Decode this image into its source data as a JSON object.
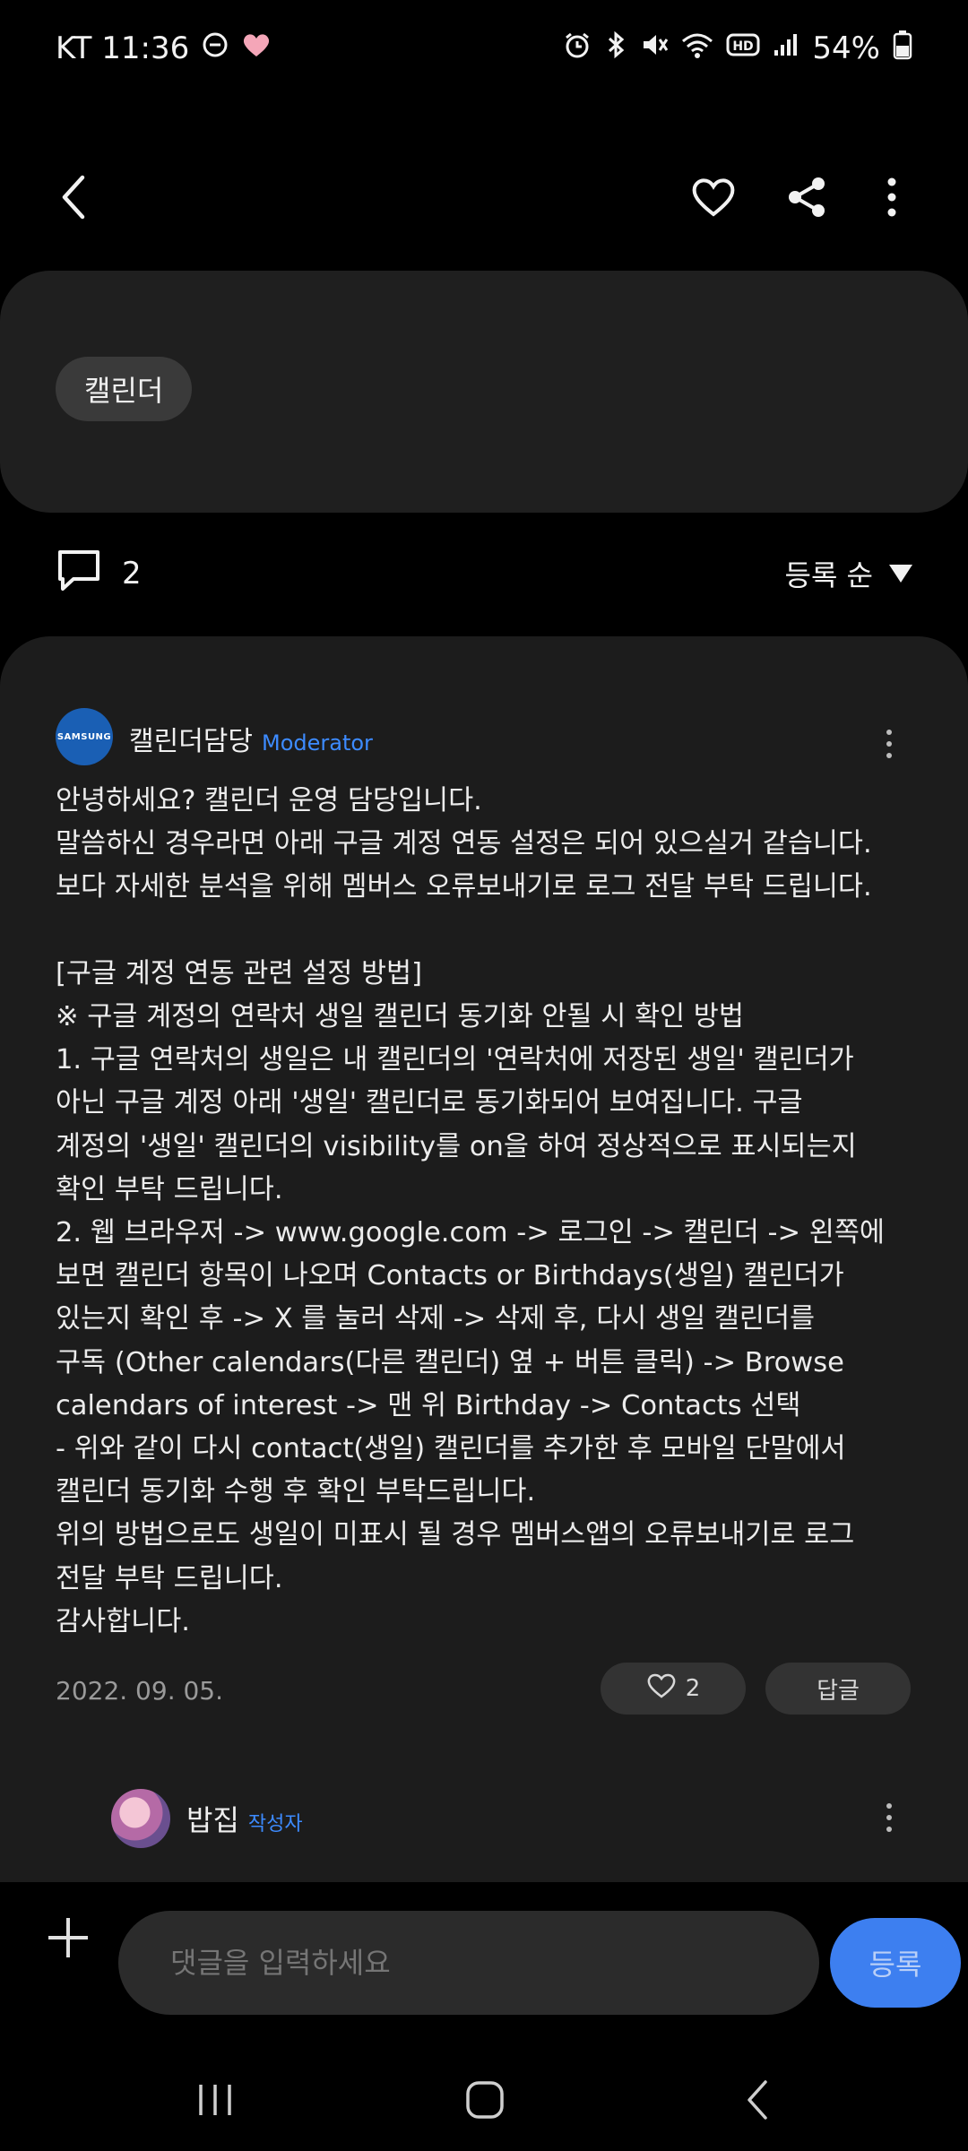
{
  "status_bar": {
    "carrier_time": "KT 11:36",
    "battery": "54%",
    "left_icons": [
      "do-not-disturb-icon",
      "heart-icon"
    ],
    "right_icons": [
      "alarm-icon",
      "bluetooth-icon",
      "mute-icon",
      "wifi-icon",
      "hd-icon",
      "signal-icon",
      "battery-icon"
    ]
  },
  "top_bar": {
    "icons": [
      "back-icon",
      "heart-outline-icon",
      "share-icon",
      "more-icon"
    ]
  },
  "tag": {
    "label": "캘린더"
  },
  "comments_header": {
    "count": "2",
    "sort_label": "등록 순"
  },
  "comment": {
    "author": "캘린더담당",
    "badge": "Moderator",
    "avatar_text": "SAMSUNG",
    "body": "안녕하세요? 캘린더 운영 담당입니다.\n말씀하신 경우라면 아래 구글 계정 연동 설정은 되어 있으실거 같습니다.\n보다 자세한 분석을 위해 멤버스 오류보내기로 로그 전달 부탁 드립니다.\n\n[구글 계정 연동 관련 설정 방법]\n※ 구글 계정의 연락처 생일 캘린더 동기화 안될 시 확인 방법\n1. 구글 연락처의 생일은 내 캘린더의 '연락처에 저장된 생일' 캘린더가\n아닌 구글 계정 아래 '생일' 캘린더로 동기화되어 보여집니다. 구글\n계정의 '생일' 캘린더의 visibility를 on을 하여 정상적으로 표시되는지\n확인 부탁 드립니다.\n2. 웹 브라우저 -> www.google.com -> 로그인 -> 캘린더 -> 왼쪽에\n보면 캘린더 항목이 나오며 Contacts or Birthdays(생일) 캘린더가\n있는지 확인 후 -> X 를 눌러 삭제 -> 삭제 후, 다시 생일 캘린더를\n구독 (Other calendars(다른 캘린더) 옆 + 버튼 클릭) -> Browse\ncalendars of interest -> 맨 위 Birthday -> Contacts 선택\n- 위와 같이 다시 contact(생일) 캘린더를 추가한 후 모바일 단말에서\n캘린더 동기화 수행 후 확인 부탁드립니다.\n위의 방법으로도 생일이 미표시 될 경우 멤버스앱의 오류보내기로 로그\n전달 부탁 드립니다.\n감사합니다.",
    "date": "2022. 09. 05.",
    "like_count": "2",
    "reply_label": "답글"
  },
  "reply": {
    "author": "밥집",
    "badge": "작성자"
  },
  "input_bar": {
    "placeholder": "댓글을 입력하세요",
    "submit_label": "등록"
  },
  "nav_bar": {
    "icons": [
      "recent-apps-icon",
      "home-icon",
      "back-nav-icon"
    ]
  },
  "colors": {
    "background": "#000000",
    "card": "#1c1c1c",
    "accent": "#3d7ff0",
    "moderator_badge": "#3d8bff"
  }
}
